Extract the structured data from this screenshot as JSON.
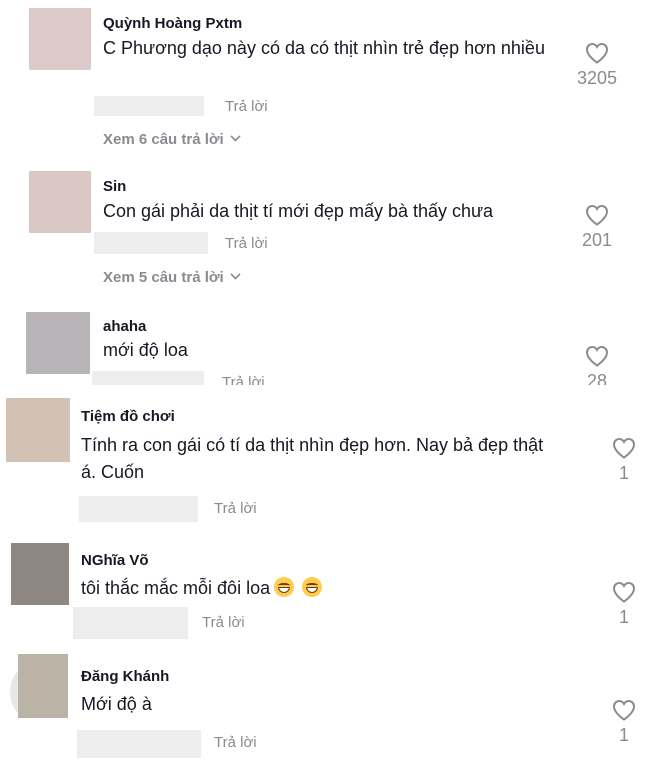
{
  "comments": [
    {
      "username": "Quỳnh Hoàng Pxtm",
      "text": "C Phương dạo này có da có thịt nhìn trẻ đẹp hơn nhiều",
      "reply_label": "Trả lời",
      "likes": "3205",
      "view_replies": "Xem 6 câu trả lời",
      "avatar_color": "#dccaca"
    },
    {
      "username": "Sin",
      "text": "Con gái phải da thịt tí mới đẹp mấy bà thấy chưa",
      "reply_label": "Trả lời",
      "likes": "201",
      "view_replies": "Xem 5 câu trả lời",
      "avatar_color": "#dbc7c3"
    },
    {
      "username": "ahaha",
      "text": "mới độ loa",
      "reply_label": "Trả lời",
      "likes": "28",
      "avatar_color": "#b9b4b8"
    },
    {
      "username": "Tiệm đồ chơi",
      "text": "Tính ra con gái có tí da thịt nhìn đẹp hơn. Nay bả đẹp thật á. Cuốn",
      "reply_label": "Trả lời",
      "likes": "1",
      "avatar_color": "#d3c1b3"
    },
    {
      "username": "NGhĩa Võ",
      "text": "tôi thắc mắc mỗi đôi loa",
      "reply_label": "Trả lời",
      "likes": "1",
      "avatar_color": "#8f8882"
    },
    {
      "username": "Đăng Khánh",
      "text": "Mới độ à",
      "reply_label": "Trả lời",
      "likes": "1",
      "avatar_color": "#bcb3a7"
    }
  ],
  "icons": {
    "like": "heart-outline-icon",
    "expand": "chevron-down-icon",
    "emoji": "grinning-face-emoji"
  },
  "colors": {
    "text": "#161823",
    "muted": "#8a8b91",
    "placeholder": "#ededed"
  }
}
